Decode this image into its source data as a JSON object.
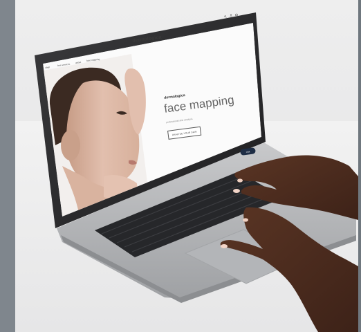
{
  "website": {
    "logo": "dermalogica",
    "nav": [
      "shop",
      "free services",
      "about",
      "face mapping"
    ],
    "hero": {
      "brand": "dermalogica",
      "title": "face mapping",
      "subtitle": "professional skin analysis",
      "button_label": "ANALYZE YOUR SKIN"
    },
    "chat_label": "chat"
  },
  "icons": [
    "search-icon",
    "account-icon",
    "bag-icon"
  ],
  "colors": {
    "background": "#7c848c",
    "laptop_body": "#b9bbbe",
    "keyboard": "#1c1c1e",
    "chat_button": "#1e2d45"
  }
}
